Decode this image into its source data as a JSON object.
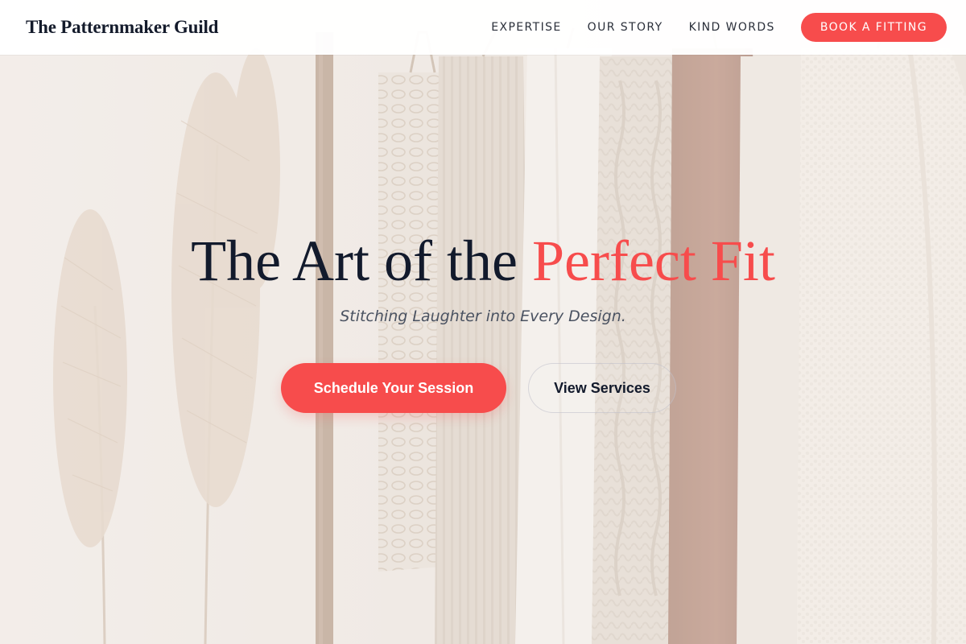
{
  "navbar": {
    "brand": "The Patternmaker Guild",
    "links": [
      {
        "label": "EXPERTISE"
      },
      {
        "label": "OUR STORY"
      },
      {
        "label": "KIND WORDS"
      }
    ],
    "cta_label": "BOOK A FITTING"
  },
  "hero": {
    "title_main": "The Art of the",
    "title_accent": "Perfect Fit",
    "tagline": "Stitching Laughter into Every Design.",
    "primary_button": "Schedule Your Session",
    "secondary_button": "View Services"
  },
  "colors": {
    "accent": "#f74c4c",
    "heading": "#121a2c",
    "background": "#efe9e3"
  }
}
